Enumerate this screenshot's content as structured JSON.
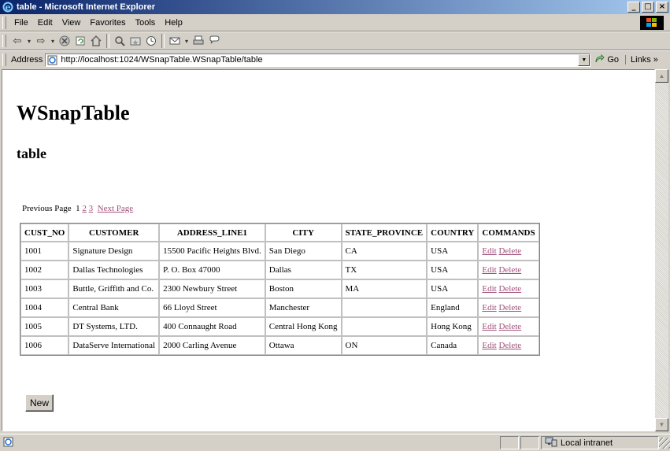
{
  "window": {
    "title": "table - Microsoft Internet Explorer"
  },
  "menubar": {
    "items": [
      "File",
      "Edit",
      "View",
      "Favorites",
      "Tools",
      "Help"
    ]
  },
  "toolbar": {
    "icons": [
      "back-icon",
      "forward-icon",
      "stop-icon",
      "refresh-icon",
      "home-icon",
      "search-icon",
      "favorites-icon",
      "history-icon",
      "mail-icon",
      "print-icon",
      "discuss-icon"
    ]
  },
  "address": {
    "label": "Address",
    "url": "http://localhost:1024/WSnapTable.WSnapTable/table",
    "go_label": "Go",
    "links_label": "Links"
  },
  "page": {
    "heading": "WSnapTable",
    "subheading": "table"
  },
  "pager": {
    "previous": "Previous Page",
    "current": "1",
    "pages": [
      "2",
      "3"
    ],
    "next": "Next Page"
  },
  "table": {
    "columns": [
      "CUST_NO",
      "CUSTOMER",
      "ADDRESS_LINE1",
      "CITY",
      "STATE_PROVINCE",
      "COUNTRY",
      "COMMANDS"
    ],
    "rows": [
      {
        "cust_no": "1001",
        "customer": "Signature Design",
        "address": "15500 Pacific Heights Blvd.",
        "city": "San Diego",
        "state": "CA",
        "country": "USA"
      },
      {
        "cust_no": "1002",
        "customer": "Dallas Technologies",
        "address": "P. O. Box 47000",
        "city": "Dallas",
        "state": "TX",
        "country": "USA"
      },
      {
        "cust_no": "1003",
        "customer": "Buttle, Griffith and Co.",
        "address": "2300 Newbury Street",
        "city": "Boston",
        "state": "MA",
        "country": "USA"
      },
      {
        "cust_no": "1004",
        "customer": "Central Bank",
        "address": "66 Lloyd Street",
        "city": "Manchester",
        "state": "",
        "country": "England"
      },
      {
        "cust_no": "1005",
        "customer": "DT Systems, LTD.",
        "address": "400 Connaught Road",
        "city": "Central Hong Kong",
        "state": "",
        "country": "Hong Kong"
      },
      {
        "cust_no": "1006",
        "customer": "DataServe International",
        "address": "2000 Carling Avenue",
        "city": "Ottawa",
        "state": "ON",
        "country": "Canada"
      }
    ],
    "edit_label": "Edit",
    "delete_label": "Delete"
  },
  "new_button": "New",
  "status": {
    "zone": "Local intranet"
  },
  "colors": {
    "titlebar_start": "#0a246a",
    "titlebar_end": "#a6caf0",
    "link_visited": "#a0507a",
    "chrome": "#d4d0c8"
  }
}
